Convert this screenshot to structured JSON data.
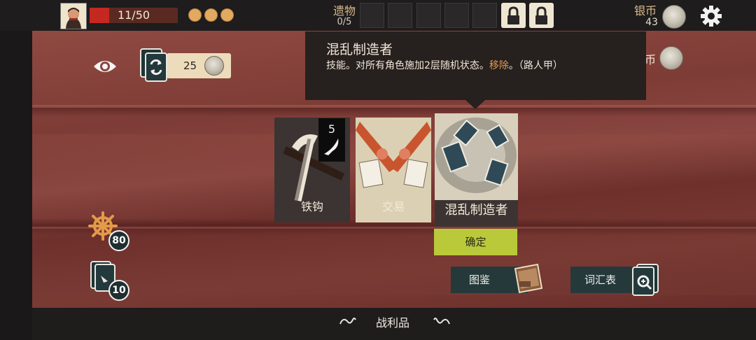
{
  "player": {
    "hp_text": "11/50",
    "hp_fraction": 0.22,
    "energy_orbs": 3
  },
  "relics": {
    "label": "遗物",
    "count": "0/5",
    "empty_slots": 5,
    "locked_slots": 2
  },
  "currency": {
    "label": "银币",
    "amount": "43",
    "partial_label": "币"
  },
  "tooltip": {
    "title": "混乱制造者",
    "desc_prefix": "技能。对所有角色施加2层随机状态。",
    "desc_highlight": "移除",
    "desc_suffix": "。（路人甲）"
  },
  "reroll": {
    "cost": "25"
  },
  "cards": [
    {
      "name": "铁钩",
      "cost": "5"
    },
    {
      "name": "交易"
    },
    {
      "name": "混乱制造者",
      "selected": true
    }
  ],
  "buttons": {
    "confirm": "确定",
    "codex": "图鉴",
    "glossary": "词汇表"
  },
  "left_panel": {
    "helm_value": "80",
    "deck_count": "10"
  },
  "footer": {
    "title": "战利品"
  },
  "colors": {
    "accent_green": "#b9c93a",
    "hp_red": "#c4281e",
    "highlight_orange": "#e39a49"
  },
  "icons": [
    "portrait-avatar",
    "eye-icon",
    "reroll-cards-icon",
    "silver-coin-icon",
    "gear-icon",
    "lock-icon",
    "ship-wheel-icon",
    "deck-icon",
    "codex-book-icon",
    "glossary-magnifier-icon",
    "swirl-ornament-icon"
  ]
}
